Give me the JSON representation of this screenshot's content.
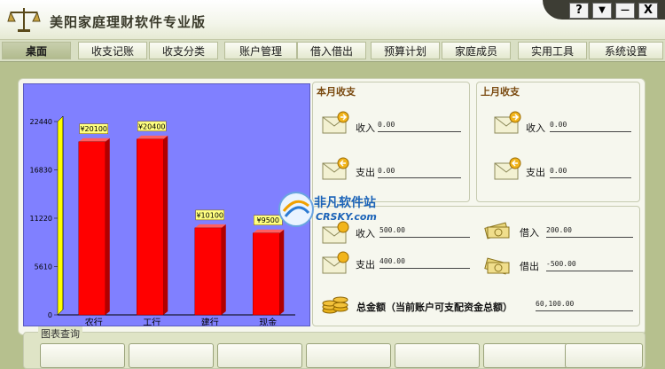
{
  "app": {
    "title": "美阳家庭理财软件专业版"
  },
  "window_controls": {
    "help": "?",
    "menu": "▼",
    "minimize": "—",
    "close": "X"
  },
  "tabs": [
    {
      "label": "桌面",
      "active": true
    },
    {
      "label": "收支记账"
    },
    {
      "label": "收支分类"
    },
    {
      "label": "账户管理"
    },
    {
      "label": "借入借出"
    },
    {
      "label": "预算计划"
    },
    {
      "label": "家庭成员"
    },
    {
      "label": "实用工具"
    },
    {
      "label": "系统设置"
    }
  ],
  "chart_data": {
    "type": "bar",
    "categories": [
      "农行",
      "工行",
      "建行",
      "现金"
    ],
    "values": [
      20100,
      20400,
      10100,
      9500
    ],
    "data_labels": [
      "¥20100",
      "¥20400",
      "¥10100",
      "¥9500"
    ],
    "y_ticks": [
      "0",
      "5610",
      "11220",
      "16830",
      "22440"
    ],
    "ylim": [
      0,
      22440
    ],
    "bar_color": "#ff0000",
    "plot_bg": "#8080ff"
  },
  "this_month": {
    "title": "本月收支",
    "income_label": "收入",
    "income_value": "0.00",
    "expense_label": "支出",
    "expense_value": "0.00"
  },
  "last_month": {
    "title": "上月收支",
    "income_label": "收入",
    "income_value": "0.00",
    "expense_label": "支出",
    "expense_value": "0.00"
  },
  "summary": {
    "income_label": "收入",
    "income_value": "500.00",
    "expense_label": "支出",
    "expense_value": "400.00",
    "borrow_in_label": "借入",
    "borrow_in_value": "200.00",
    "lend_out_label": "借出",
    "lend_out_value": "-500.00",
    "total_label": "总金额（当前账户可支配资金总额）",
    "total_value": "60,100.00"
  },
  "watermark": {
    "name": "非凡软件站",
    "site": "CRSKY.com"
  },
  "chart_query": {
    "title": "图表查询",
    "buttons": [
      "",
      "",
      "",
      "",
      "",
      "",
      ""
    ]
  },
  "colors": {
    "accent": "#7a4a10",
    "background": "#b6c08e"
  }
}
